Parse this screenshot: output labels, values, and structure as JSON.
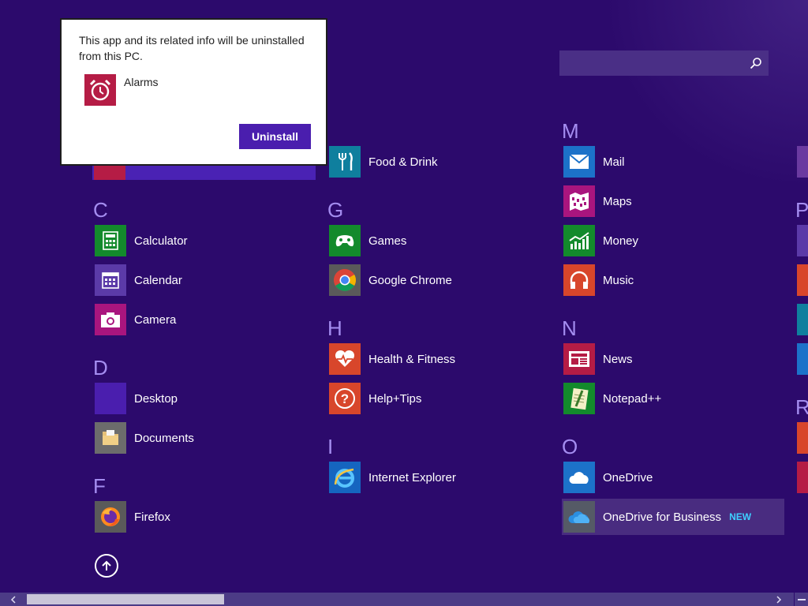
{
  "search": {
    "placeholder": "",
    "value": ""
  },
  "dialog": {
    "message": "This app and its related info will be uninstalled from this PC.",
    "app_name": "Alarms",
    "button": "Uninstall"
  },
  "groups": {
    "C": "C",
    "D": "D",
    "F": "F",
    "G": "G",
    "H": "H",
    "I": "I",
    "M": "M",
    "N": "N",
    "O": "O"
  },
  "apps": {
    "food_drink": "Food & Drink",
    "calculator": "Calculator",
    "calendar": "Calendar",
    "camera": "Camera",
    "desktop": "Desktop",
    "documents": "Documents",
    "firefox": "Firefox",
    "games": "Games",
    "google_chrome": "Google Chrome",
    "health_fitness": "Health & Fitness",
    "help_tips": "Help+Tips",
    "internet_explorer": "Internet Explorer",
    "mail": "Mail",
    "maps": "Maps",
    "money": "Money",
    "music": "Music",
    "news": "News",
    "notepadpp": "Notepad++",
    "onedrive": "OneDrive",
    "onedrive_business": "OneDrive for Business",
    "new_badge": "NEW"
  },
  "edge_letters": {
    "p": "P",
    "r": "R"
  },
  "colors": {
    "background": "#2c0a6c",
    "letter": "#a48df0",
    "accent_button": "#4a1eae",
    "new_badge": "#3ed0ff"
  }
}
